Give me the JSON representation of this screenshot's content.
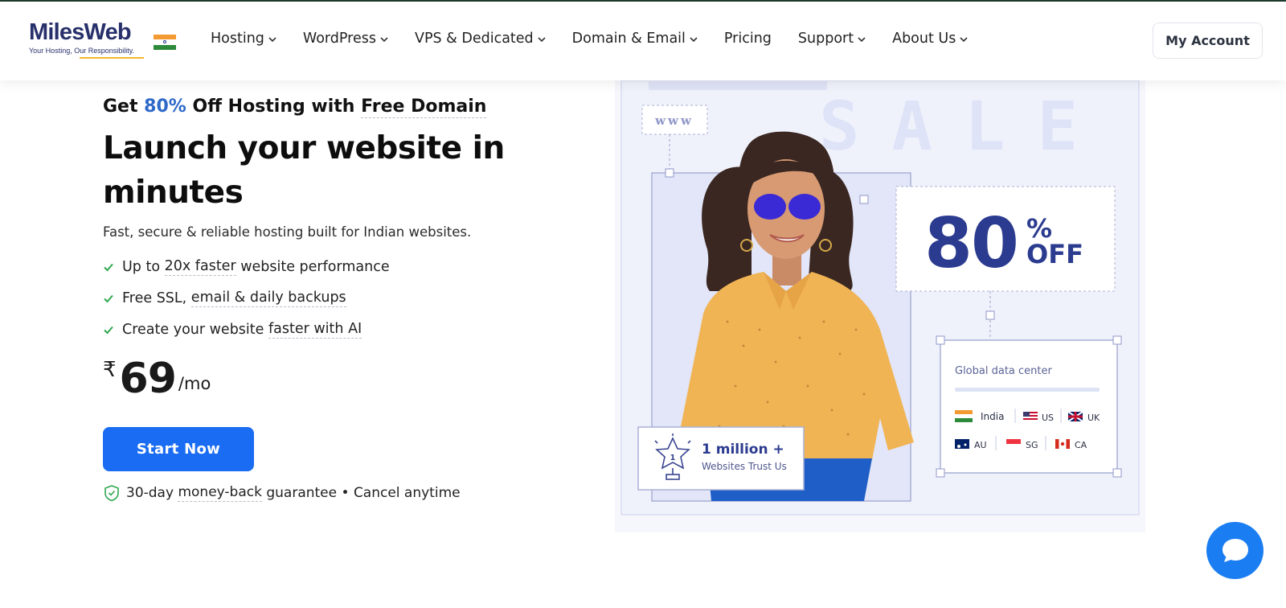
{
  "brand": {
    "name": "MilesWeb",
    "tagline": "Your Hosting, Our Responsibility."
  },
  "nav": {
    "items": [
      {
        "label": "Hosting",
        "has_dropdown": true
      },
      {
        "label": "WordPress",
        "has_dropdown": true
      },
      {
        "label": "VPS & Dedicated",
        "has_dropdown": true
      },
      {
        "label": "Domain & Email",
        "has_dropdown": true
      },
      {
        "label": "Pricing",
        "has_dropdown": false
      },
      {
        "label": "Support",
        "has_dropdown": true
      },
      {
        "label": "About Us",
        "has_dropdown": true
      }
    ],
    "account_label": "My Account"
  },
  "hero": {
    "offer_prefix": "Get ",
    "offer_percent": "80%",
    "offer_middle": " Off Hosting with ",
    "offer_domain": "Free Domain",
    "headline": "Launch your website in minutes",
    "subtitle": "Fast, secure & reliable hosting built for Indian websites.",
    "features": [
      {
        "pre": "Up to ",
        "hl": "20x faster",
        "post": " website performance"
      },
      {
        "pre": "Free SSL, ",
        "hl": "email & daily backups",
        "post": ""
      },
      {
        "pre": "Create your website ",
        "hl": "faster with AI",
        "post": ""
      }
    ],
    "price_currency": "₹",
    "price_amount": "69",
    "price_period": "/mo",
    "cta_label": "Start Now",
    "guarantee_pre": "30-day ",
    "guarantee_hl": "money-back",
    "guarantee_post": " guarantee • Cancel anytime"
  },
  "promo": {
    "url_badge": "www",
    "sale_text": "SALE",
    "discount_number": "80",
    "discount_percent": "%",
    "discount_off": "OFF",
    "trust_count": "1 million +",
    "trust_label": "Websites Trust Us",
    "datacenter_title": "Global data center",
    "locations": [
      "India",
      "US",
      "UK",
      "AU",
      "SG",
      "CA"
    ]
  },
  "colors": {
    "brand_navy": "#27306b",
    "accent_blue": "#1a6df2",
    "check_green": "#2fa84f",
    "promo_navy": "#2b3b8f",
    "chat_blue": "#1a7ef2"
  },
  "icons": [
    "chevron-down-icon",
    "check-icon",
    "shield-icon",
    "trophy-icon",
    "chat-icon",
    "flag-icon"
  ]
}
